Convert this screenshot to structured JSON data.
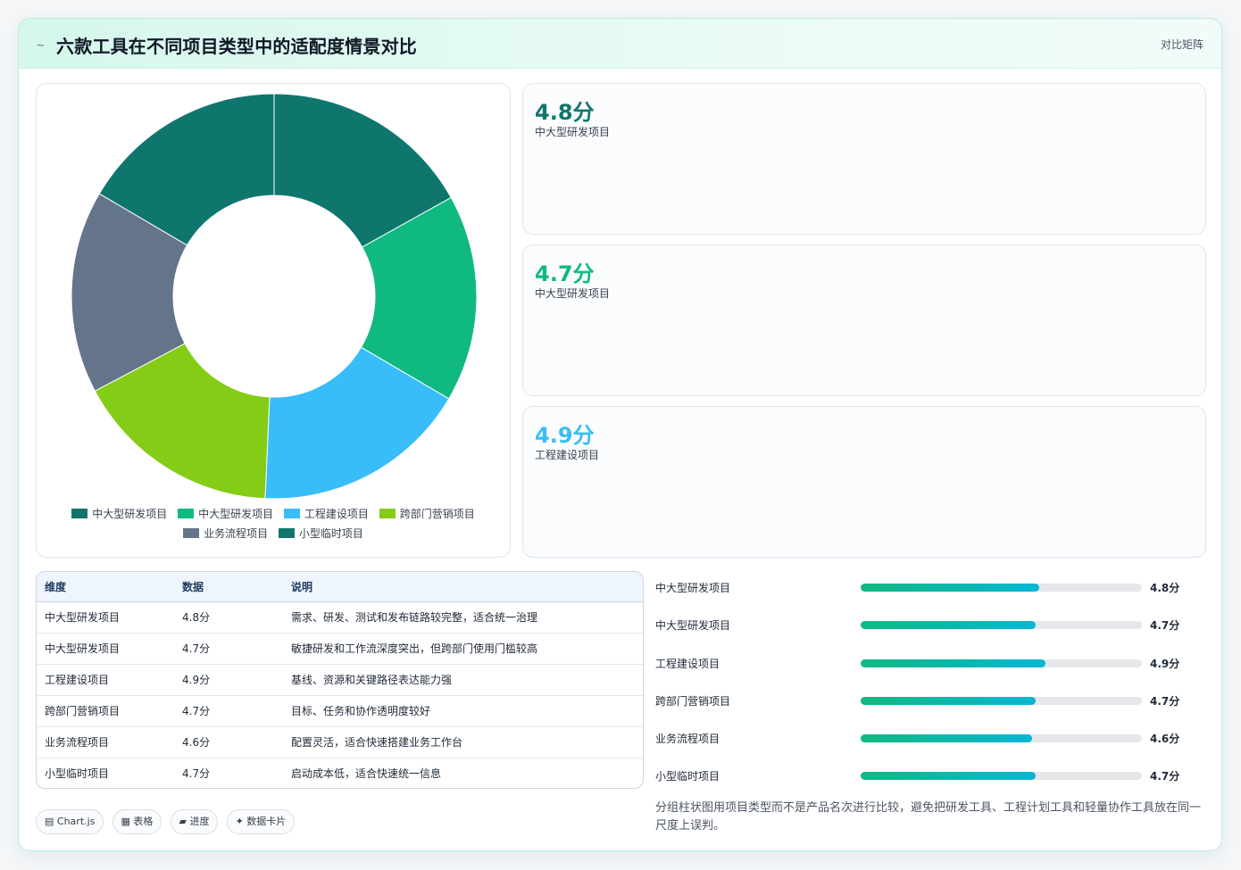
{
  "header": {
    "logo_icon": "~",
    "title": "六款工具在不同项目类型中的适配度情景对比",
    "tag": "对比矩阵"
  },
  "chart_data": {
    "type": "pie",
    "categories": [
      "中大型研发项目",
      "中大型研发项目",
      "工程建设项目",
      "跨部门营销项目",
      "业务流程项目",
      "小型临时项目"
    ],
    "values": [
      4.8,
      4.7,
      4.9,
      4.7,
      4.6,
      4.7
    ],
    "colors": [
      "#0f766e",
      "#10b981",
      "#38bdf8",
      "#84cc16",
      "#64748b",
      "#0f766e"
    ],
    "legend_position": "bottom",
    "donut": true
  },
  "stats": [
    {
      "value": "4.8分",
      "label": "中大型研发项目",
      "color": "#0f766e"
    },
    {
      "value": "4.7分",
      "label": "中大型研发项目",
      "color": "#10b981"
    },
    {
      "value": "4.9分",
      "label": "工程建设项目",
      "color": "#38bdf8"
    }
  ],
  "table": {
    "headers": [
      "维度",
      "数据",
      "说明"
    ],
    "rows": [
      [
        "中大型研发项目",
        "4.8分",
        "需求、研发、测试和发布链路较完整，适合统一治理"
      ],
      [
        "中大型研发项目",
        "4.7分",
        "敏捷研发和工作流深度突出，但跨部门使用门槛较高"
      ],
      [
        "工程建设项目",
        "4.9分",
        "基线、资源和关键路径表达能力强"
      ],
      [
        "跨部门营销项目",
        "4.7分",
        "目标、任务和协作透明度较好"
      ],
      [
        "业务流程项目",
        "4.6分",
        "配置灵活，适合快速搭建业务工作台"
      ],
      [
        "小型临时项目",
        "4.7分",
        "启动成本低，适合快速统一信息"
      ]
    ]
  },
  "bars": [
    {
      "label": "中大型研发项目",
      "value_text": "4.8分",
      "fraction": 0.635
    },
    {
      "label": "中大型研发项目",
      "value_text": "4.7分",
      "fraction": 0.622
    },
    {
      "label": "工程建设项目",
      "value_text": "4.9分",
      "fraction": 0.657
    },
    {
      "label": "跨部门营销项目",
      "value_text": "4.7分",
      "fraction": 0.622
    },
    {
      "label": "业务流程项目",
      "value_text": "4.6分",
      "fraction": 0.609
    },
    {
      "label": "小型临时项目",
      "value_text": "4.7分",
      "fraction": 0.622
    }
  ],
  "chips": [
    {
      "icon": "▤",
      "label": "Chart.js"
    },
    {
      "icon": "▦",
      "label": "表格"
    },
    {
      "icon": "▰",
      "label": "进度"
    },
    {
      "icon": "✦",
      "label": "数据卡片"
    }
  ],
  "note": "分组柱状图用项目类型而不是产品名次进行比较，避免把研发工具、工程计划工具和轻量协作工具放在同一尺度上误判。"
}
